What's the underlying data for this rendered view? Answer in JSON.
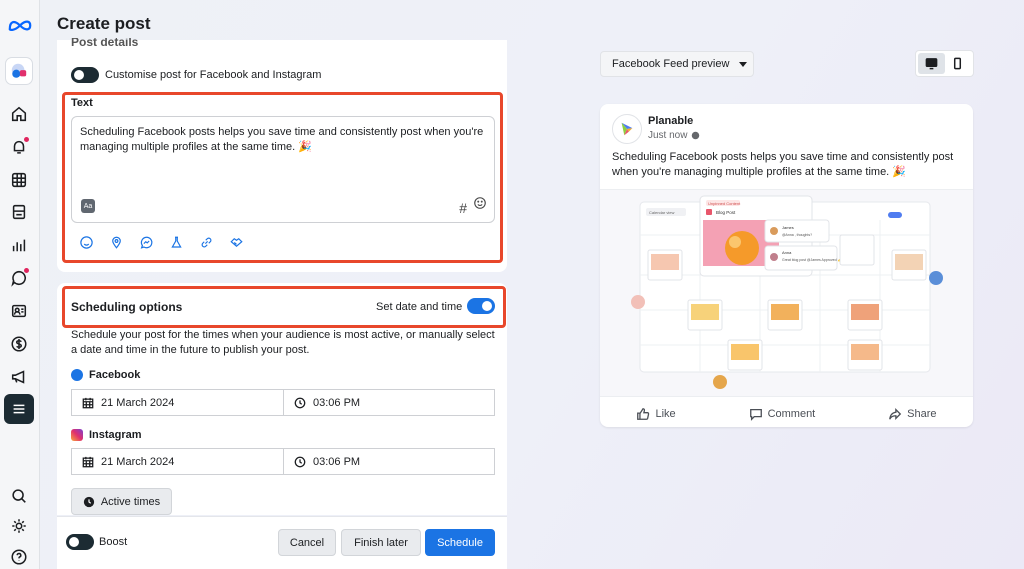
{
  "page": {
    "title": "Create post"
  },
  "colors": {
    "accent": "#1b74e4",
    "highlight": "#e8472b",
    "nav_dark": "#1c2b33"
  },
  "nav": {
    "icons": [
      "meta-logo-icon",
      "account-avatar-icon",
      "home-icon",
      "notifications-icon",
      "grid-icon",
      "pages-icon",
      "insights-icon",
      "messages-icon",
      "contacts-icon",
      "monetization-icon",
      "ads-icon",
      "menu-icon",
      "search-icon",
      "settings-icon",
      "help-icon"
    ]
  },
  "post_details": {
    "section_title": "Post details",
    "customise_label": "Customise post for Facebook and Instagram",
    "customise_on": false
  },
  "text_section": {
    "title": "Text",
    "content": "Scheduling Facebook posts helps you save time and consistently post when you're managing multiple profiles at the same time. 🎉",
    "style_icon": "Aa",
    "hashtag_icon": "#",
    "tools": [
      "emoji-icon",
      "location-icon",
      "messenger-icon",
      "lab-icon",
      "link-icon",
      "handshake-icon"
    ]
  },
  "scheduling": {
    "title": "Scheduling options",
    "toggle_label": "Set date and time",
    "toggle_on": true,
    "description": "Schedule your post for the times when your audience is most active, or manually select a date and time in the future to publish your post.",
    "facebook": {
      "label": "Facebook",
      "date": "21 March 2024",
      "time": "03:06 PM"
    },
    "instagram": {
      "label": "Instagram",
      "date": "21 March 2024",
      "time": "03:06 PM"
    },
    "active_times_label": "Active times"
  },
  "footer": {
    "boost_label": "Boost",
    "boost_on": false,
    "cancel_label": "Cancel",
    "finish_later_label": "Finish later",
    "schedule_label": "Schedule"
  },
  "preview": {
    "selector_label": "Facebook Feed preview",
    "page_name": "Planable",
    "timestamp": "Just now",
    "post_text": "Scheduling Facebook posts helps you save time and consistently post when you're managing multiple profiles at the same time. 🎉",
    "image_labels": {
      "calendar_view": "Calendar view",
      "blog_post": "Blog Post",
      "unpinned": "Unpinned Content",
      "comment1_name": "James",
      "comment1_text": "@Anna , thoughts?",
      "comment2_name": "Anna",
      "comment2_text": "Great blog post @James Approved 👍"
    },
    "like_label": "Like",
    "comment_label": "Comment",
    "share_label": "Share"
  }
}
